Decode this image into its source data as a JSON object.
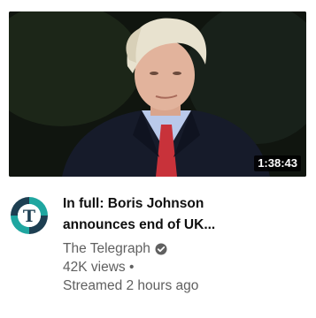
{
  "video": {
    "duration": "1:38:43",
    "title_line1": "In full: Boris Johnson",
    "title_line2": "announces end of UK...",
    "channel": "The Telegraph",
    "views": "42K views •",
    "streamed": "Streamed 2 hours ago"
  },
  "icons": {
    "channel_avatar": "telegraph-logo-icon",
    "verified": "verified-check-icon"
  },
  "colors": {
    "avatar_teal": "#1fa6a0",
    "avatar_navy": "#1d3f52",
    "tie_red": "#c8323a"
  }
}
